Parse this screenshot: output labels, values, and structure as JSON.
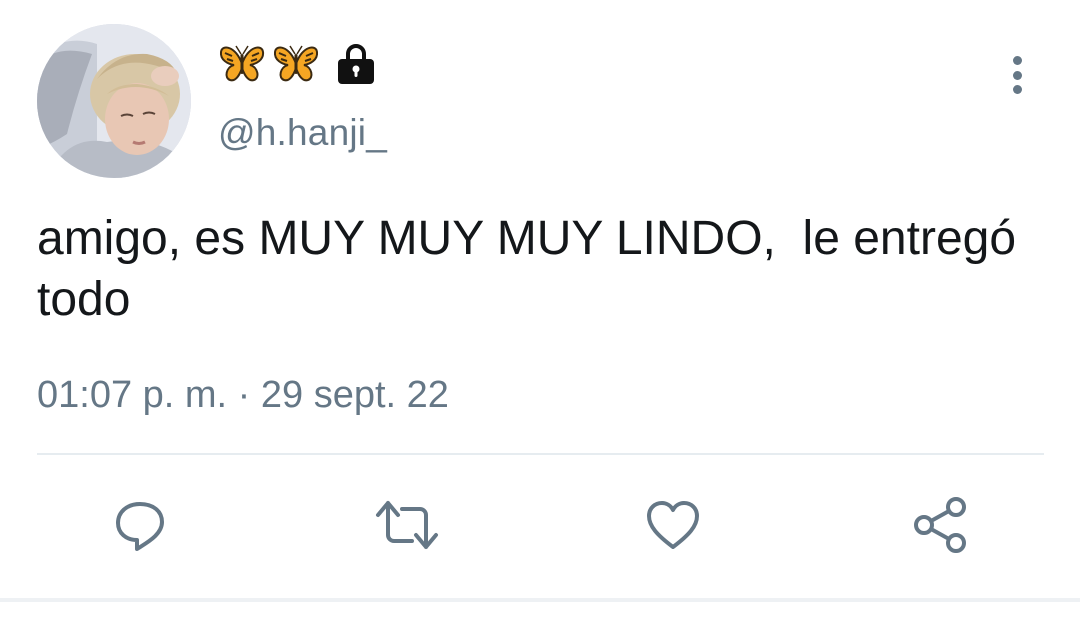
{
  "header": {
    "display_name_icons": [
      "butterfly-emoji",
      "butterfly-emoji",
      "lock-icon"
    ],
    "handle": "@h.hanji_"
  },
  "tweet": {
    "text": "amigo, es MUY MUY MUY LINDO,  le entregó todo",
    "time": "01:07 p. m.",
    "separator": " · ",
    "date": "29 sept. 22"
  },
  "actions": [
    "reply-icon",
    "retweet-icon",
    "like-icon",
    "share-icon"
  ],
  "colors": {
    "text": "#14171a",
    "secondary": "#657786",
    "divider": "#e6ecf0",
    "butterfly": "#f5a623"
  }
}
